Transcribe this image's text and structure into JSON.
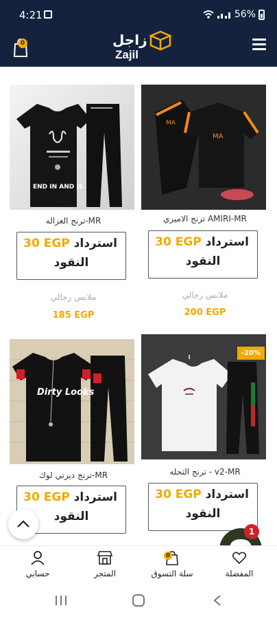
{
  "status": {
    "time": "4:21",
    "battery": "56%"
  },
  "appbar": {
    "cart_count": "0",
    "logo_ar": "زاجل",
    "logo_en": "Zajil"
  },
  "products": [
    {
      "name": "ترنج الغزاله-MR",
      "refund_amount": "30 EGP",
      "refund_word": "استرداد",
      "refund_line2": "النقود",
      "category": "ملابس رجالي",
      "price": "185 EGP",
      "img_text": "END IN AND IS",
      "badge": ""
    },
    {
      "name": "ترنج الاميري AMIRI-MR",
      "refund_amount": "30 EGP",
      "refund_word": "استرداد",
      "refund_line2": "النقود",
      "category": "ملابس رجالي",
      "price": "200 EGP",
      "img_text": "",
      "badge": ""
    },
    {
      "name": "ترنج ديرتي لوك-MR",
      "refund_amount": "30 EGP",
      "refund_word": "استرداد",
      "refund_line2": "النقود",
      "category": "",
      "price": "",
      "img_text": "Dirty Looks",
      "badge": ""
    },
    {
      "name": "ترنج التحله - v2-MR",
      "refund_amount": "30 EGP",
      "refund_word": "استرداد",
      "refund_line2": "النقود",
      "category": "",
      "price": "",
      "img_text": "",
      "badge": "-20%"
    }
  ],
  "chat": {
    "badge": "1"
  },
  "bottom_nav": [
    {
      "label": "حسابي",
      "icon": "user-icon"
    },
    {
      "label": "المتجر",
      "icon": "store-icon"
    },
    {
      "label": "سلة التسوق",
      "icon": "bag-icon",
      "badge": "0"
    },
    {
      "label": "المفضلة",
      "icon": "heart-icon"
    }
  ],
  "colors": {
    "header": "#15223e",
    "accent": "#f2a900"
  }
}
